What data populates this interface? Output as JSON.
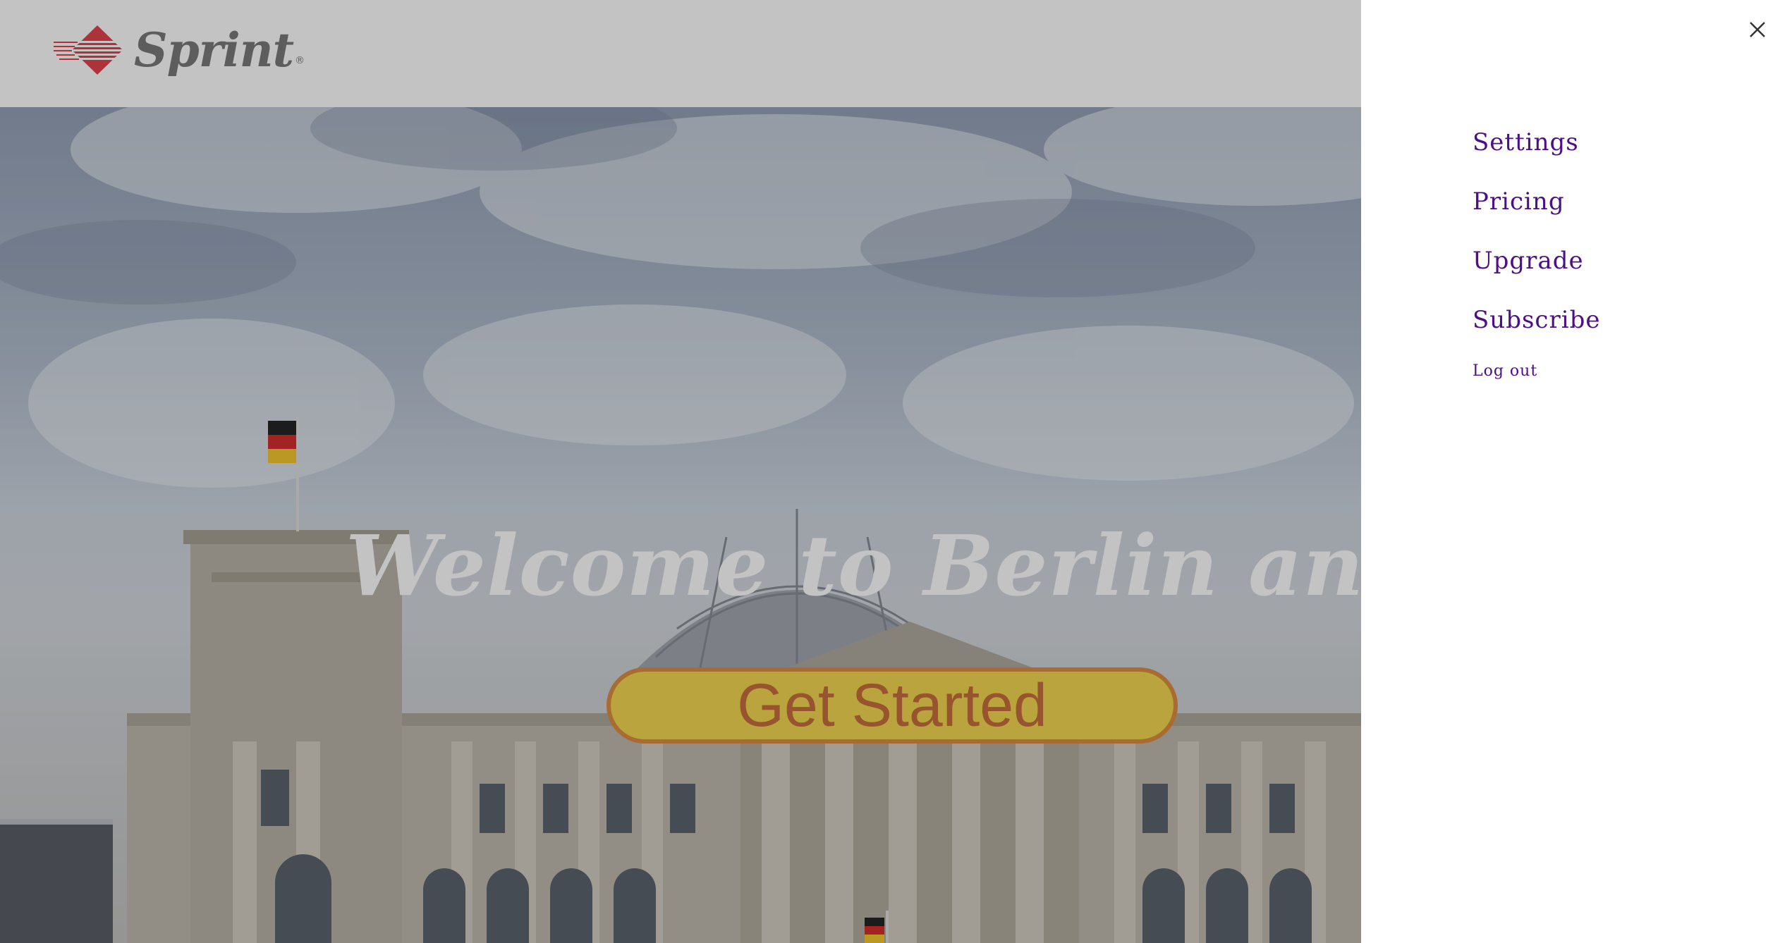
{
  "header": {
    "logo_text": "Sprint",
    "logo_reg_mark": "®"
  },
  "hero": {
    "title": "Welcome to Berlin and the future",
    "cta_label": "Get Started"
  },
  "drawer": {
    "menu_items": [
      {
        "label": "Settings"
      },
      {
        "label": "Pricing"
      },
      {
        "label": "Upgrade"
      },
      {
        "label": "Subscribe"
      }
    ],
    "logout_label": "Log out"
  },
  "colors": {
    "menu_text": "#4c0f87",
    "cta_fill": "#f1d33f",
    "cta_border": "#d9812e",
    "cta_text": "#c2602a",
    "logo_red": "#e0303a",
    "logo_gray": "#6e6e6e"
  },
  "icons": {
    "close": "close-icon",
    "logo_mark": "sprint-diamond-logo"
  }
}
